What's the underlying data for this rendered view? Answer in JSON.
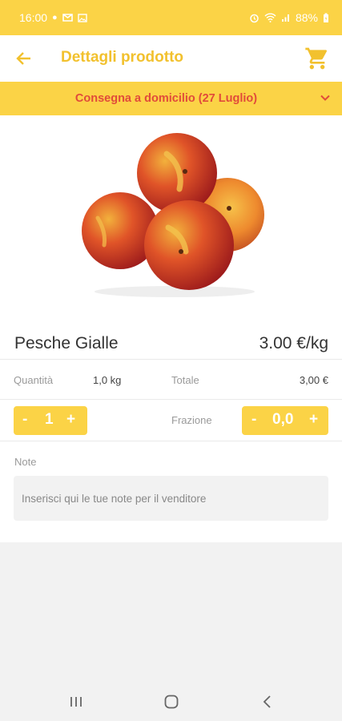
{
  "status_bar": {
    "time": "16:00",
    "battery": "88%",
    "left_icons": [
      "chat-bubble-icon",
      "gmail-icon",
      "gallery-icon"
    ],
    "right_icons": [
      "alarm-icon",
      "wifi-icon",
      "signal-icon",
      "battery-charging-icon"
    ]
  },
  "app_bar": {
    "title": "Dettagli prodotto",
    "accent_color": "#f2c12e"
  },
  "delivery": {
    "label": "Consegna a domicilio (27 Luglio)",
    "text_color": "#e14b3a",
    "bar_color": "#fbd346"
  },
  "product": {
    "name": "Pesche Gialle",
    "price": "3.00 €/kg",
    "image_icon": "peaches-image"
  },
  "quantity": {
    "label": "Quantità",
    "value": "1,0 kg",
    "total_label": "Totale",
    "total_value": "3,00 €"
  },
  "unit_stepper": {
    "minus": "-",
    "value": "1",
    "plus": "+"
  },
  "fraction": {
    "label": "Frazione",
    "minus": "-",
    "value": "0,0",
    "plus": "+"
  },
  "notes": {
    "label": "Note",
    "placeholder": "Inserisci qui le tue note per il venditore"
  },
  "nav": {
    "icons": [
      "recent-apps-icon",
      "home-icon",
      "back-nav-icon"
    ]
  }
}
